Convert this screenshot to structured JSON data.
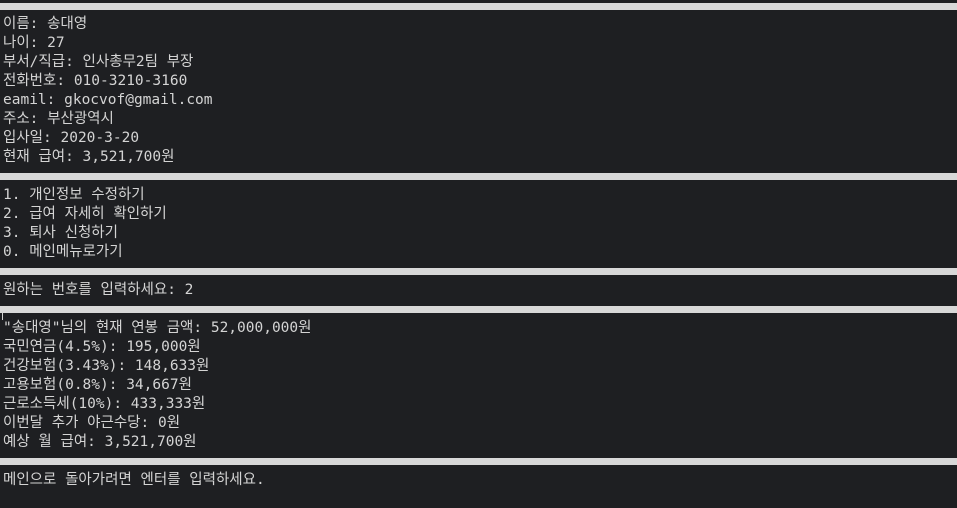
{
  "employee_info": {
    "name": "이름: 송대영",
    "age": "나이: 27",
    "dept_title": "부서/직급: 인사총무2팀 부장",
    "phone": "전화번호: 010-3210-3160",
    "email": "eamil: gkocvof@gmail.com",
    "address": "주소: 부산광역시",
    "hire_date": "입사일: 2020-3-20",
    "salary": "현재 급여: 3,521,700원"
  },
  "menu": {
    "items": [
      "1. 개인정보 수정하기",
      "2. 급여 자세히 확인하기",
      "3. 퇴사 신청하기",
      "0. 메인메뉴로가기"
    ]
  },
  "prompt": {
    "text": "원하는 번호를 입력하세요: 2"
  },
  "salary_detail": {
    "annual": "\"송대영\"님의 현재 연봉 금액: 52,000,000원",
    "pension": "국민연금(4.5%): 195,000원",
    "health": "건강보험(3.43%): 148,633원",
    "employment": "고용보험(0.8%): 34,667원",
    "income_tax": "근로소득세(10%): 433,333원",
    "night_allowance": "이번달 추가 야근수당: 0원",
    "expected_monthly": "예상 월 급여: 3,521,700원"
  },
  "footer": {
    "text": "메인으로 돌아가려면 엔터를 입력하세요."
  }
}
